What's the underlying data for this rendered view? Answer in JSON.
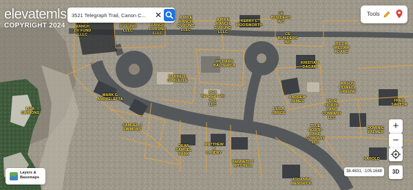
{
  "app": {
    "name": "elevatemls",
    "copyright": "COPYRIGHT 2024"
  },
  "search": {
    "value": "3521 Telegraph Trail, Canon C...",
    "placeholder": "Search address"
  },
  "tools": {
    "label": "Tools",
    "icons": [
      "pencil-icon",
      "map-pin-icon"
    ]
  },
  "map_controls": {
    "zoom_in": "+",
    "zoom_out": "−",
    "locate_icon": "crosshair-icon",
    "view_3d": "3D",
    "coordinates": "38.4631, -105.1648"
  },
  "layers_button": {
    "label": "Layers &\nBasemaps",
    "icon": "layers-icon"
  },
  "colors": {
    "parcel_label": "#ffe24a",
    "parcel_line": "#e8a33a",
    "search_button": "#1a73e8",
    "road": "#55585a",
    "accent_red": "#e53935"
  },
  "parcels": [
    {
      "label": "A MILE\nRANCH\nDV FUND\nLLLC"
    },
    {
      "label": "A MILE\nRANCH\nDV FUND\nLLLC"
    },
    {
      "label": "A MILE\nRANCH\nDV FUND\nLLLC"
    },
    {
      "label": "A MILE\nRANCH\nDV FUND\nLLLC"
    },
    {
      "label": "A MILE\nRANCH\nDV FUND\nLLLC"
    },
    {
      "label": "KERRY L\nWOOSWORTH"
    },
    {
      "label": "CE\nBUILDERS\nINC"
    },
    {
      "label": "CE\nBUILDERS\nINC"
    },
    {
      "label": "HILDA\nWILLIAM\nADAMS"
    },
    {
      "label": "RICHARD\nBALDEMOA"
    },
    {
      "label": "KRISTIAN\nDAGAM"
    },
    {
      "label": "DARRELL\nGRAVELLE"
    },
    {
      "label": "3521\nTELEGRAPH\nTRL\nLLC"
    },
    {
      "label": "MARK G\nANDRELETTA"
    },
    {
      "label": "MASON\nHOWELL\nGREENE"
    },
    {
      "label": "ANDREW\nJAMES"
    },
    {
      "label": "FRED\nSARTOR"
    },
    {
      "label": "TRUE\nNORTH\nLAND\nCOMPANY\nLLC"
    },
    {
      "label": "LEILA\nLANGE"
    },
    {
      "label": "SAMUEL J\nSIMMONS"
    },
    {
      "label": "TRUE\nNORTH\nLAND\nCOMPANY\nLLC"
    },
    {
      "label": "DOMINIC\nPALMER"
    },
    {
      "label": "DEAN\nSAMUEL\nPARK"
    },
    {
      "label": "MATTHEW\nB\nLANDRY"
    },
    {
      "label": "KENNETH J\nMITCHELL"
    },
    {
      "label": "HAROLD"
    },
    {
      "label": "JOHANNA\nMENDRICK"
    },
    {
      "label": "LISA\nSIMMONS"
    }
  ]
}
